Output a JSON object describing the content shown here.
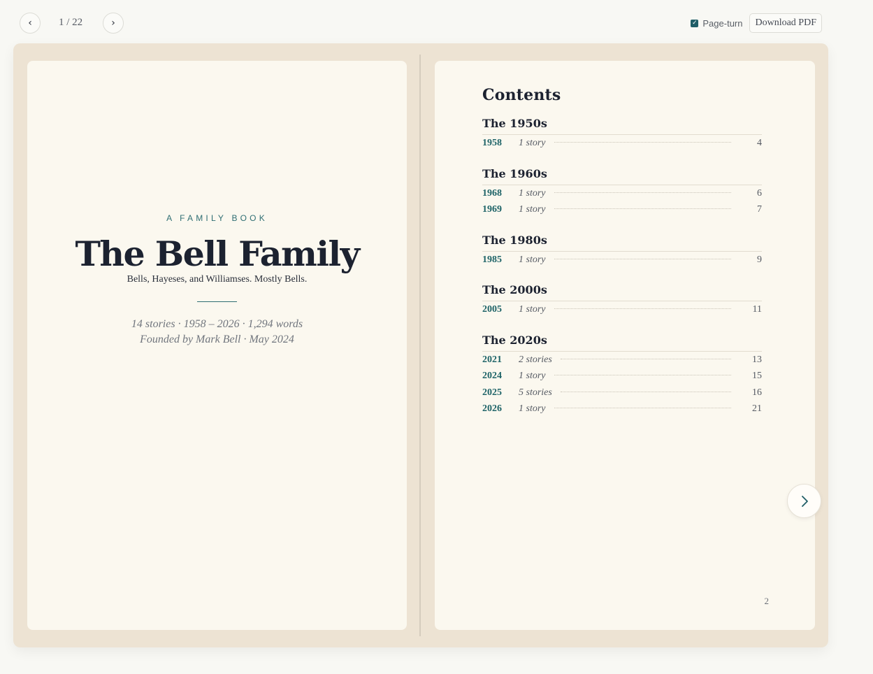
{
  "toolbar": {
    "prev_icon": "‹",
    "next_icon": "›",
    "page_indicator": "1 / 22",
    "page_turn_label": "Page-turn",
    "page_turn_checked": true,
    "download_label": "Download PDF"
  },
  "cover": {
    "eyebrow": "A FAMILY BOOK",
    "title": "The Bell Family",
    "subtitle": "Bells, Hayeses, and Williamses. Mostly Bells.",
    "meta_line1": "14 stories · 1958 – 2026 · 1,294 words",
    "meta_line2": "Founded by Mark Bell · May 2024"
  },
  "toc": {
    "title": "Contents",
    "decades": [
      {
        "title": "The 1950s",
        "entries": [
          {
            "year": "1958",
            "count": "1 story",
            "page": "4"
          }
        ]
      },
      {
        "title": "The 1960s",
        "entries": [
          {
            "year": "1968",
            "count": "1 story",
            "page": "6"
          },
          {
            "year": "1969",
            "count": "1 story",
            "page": "7"
          }
        ]
      },
      {
        "title": "The 1980s",
        "entries": [
          {
            "year": "1985",
            "count": "1 story",
            "page": "9"
          }
        ]
      },
      {
        "title": "The 2000s",
        "entries": [
          {
            "year": "2005",
            "count": "1 story",
            "page": "11"
          }
        ]
      },
      {
        "title": "The 2020s",
        "entries": [
          {
            "year": "2021",
            "count": "2 stories",
            "page": "13"
          },
          {
            "year": "2024",
            "count": "1 story",
            "page": "15"
          },
          {
            "year": "2025",
            "count": "5 stories",
            "page": "16"
          },
          {
            "year": "2026",
            "count": "1 story",
            "page": "21"
          }
        ]
      }
    ]
  },
  "page_number": "2",
  "colors": {
    "accent": "#1f6468",
    "book": "#ede3d3",
    "paper": "#fbf8ef"
  },
  "icons": {
    "next_page": "chevron-right-icon"
  }
}
